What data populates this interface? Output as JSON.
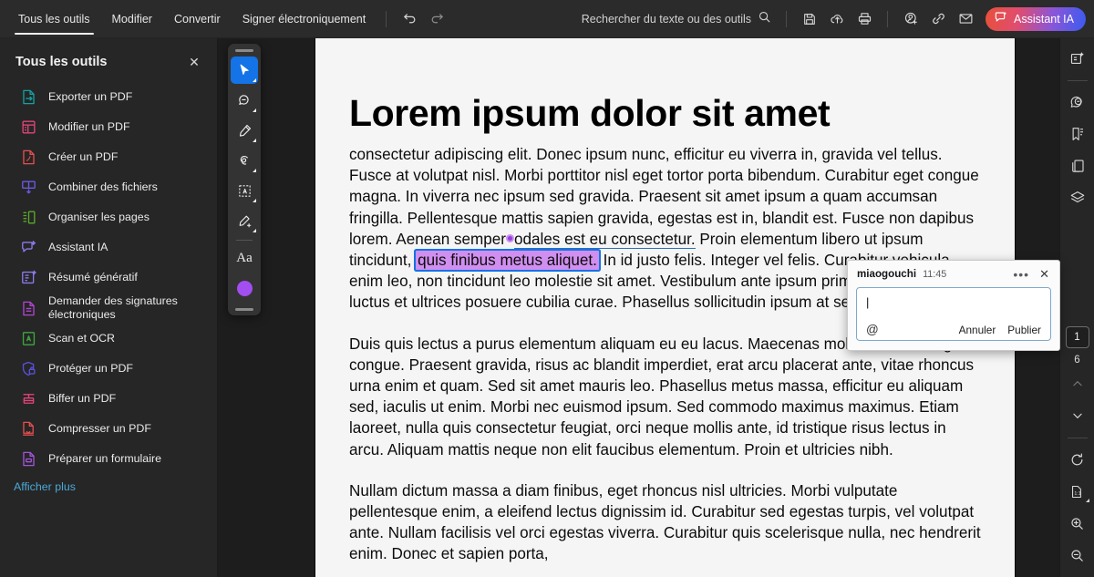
{
  "topbar": {
    "tabs": [
      {
        "label": "Tous les outils",
        "active": true
      },
      {
        "label": "Modifier",
        "active": false
      },
      {
        "label": "Convertir",
        "active": false
      },
      {
        "label": "Signer électroniquement",
        "active": false
      }
    ],
    "undo_name": "undo-icon",
    "redo_name": "redo-icon",
    "search_placeholder": "Rechercher du texte ou des outils",
    "icons": [
      "save-icon",
      "upload-cloud-icon",
      "print-icon",
      "add-person-icon",
      "link-icon",
      "mail-icon"
    ],
    "ai_button": "Assistant IA",
    "ai_gradient_from": "#e8503a",
    "ai_gradient_to": "#3a5bf0"
  },
  "sidebar": {
    "title": "Tous les outils",
    "close_label": "✕",
    "items": [
      {
        "label": "Exporter un PDF",
        "color": "#13a1a1"
      },
      {
        "label": "Modifier un PDF",
        "color": "#e0457b"
      },
      {
        "label": "Créer un PDF",
        "color": "#e34f4f"
      },
      {
        "label": "Combiner des fichiers",
        "color": "#6a5ae0"
      },
      {
        "label": "Organiser les pages",
        "color": "#5aa82b"
      },
      {
        "label": "Assistant IA",
        "color": "#8b7ae8"
      },
      {
        "label": "Résumé génératif",
        "color": "#8b7ae8"
      },
      {
        "label": "Demander des signatures électroniques",
        "color": "#b045d0"
      },
      {
        "label": "Scan et OCR",
        "color": "#3fa63f"
      },
      {
        "label": "Protéger un PDF",
        "color": "#5a50d8"
      },
      {
        "label": "Biffer un PDF",
        "color": "#e0457b"
      },
      {
        "label": "Compresser un PDF",
        "color": "#e34f4f"
      },
      {
        "label": "Préparer un formulaire",
        "color": "#a055d8"
      }
    ],
    "show_more": "Afficher plus",
    "show_more_color": "#4ba8d8"
  },
  "toolpalette": {
    "tools": [
      {
        "name": "select-cursor-tool",
        "selected": true,
        "has_caret": true
      },
      {
        "name": "comment-tool",
        "selected": false,
        "has_caret": true
      },
      {
        "name": "highlighter-tool",
        "selected": false,
        "has_caret": true
      },
      {
        "name": "freehand-draw-tool",
        "selected": false,
        "has_caret": true
      },
      {
        "name": "text-select-box-tool",
        "selected": false,
        "has_caret": true
      },
      {
        "name": "signature-tool",
        "selected": false,
        "has_caret": true
      }
    ],
    "text_tool_label": "Aa",
    "color_swatch": "#a24ef0"
  },
  "document": {
    "title": "Lorem ipsum dolor sit amet",
    "para1_a": "consectetur adipiscing elit. Donec ipsum nunc, efficitur eu viverra in, gravida vel tellus. Fusce at volutpat nisl. Morbi porttitor nisl eget tortor porta bibendum. Curabitur eget congue magna. In viverra nec ipsum sed gravida. Praesent sit amet ipsum a quam accumsan fringilla. Pellentesque mattis sapien gravida, egestas est in, blandit est. Fusce non dapibus lorem. Aenean semper",
    "para1_underlined": "odales est eu consectetur.",
    "para1_b": " Proin elementum libero ut ipsum tincidunt, ",
    "para1_highlight": "quis finibus metus aliquet.",
    "para1_c": " In id justo felis. Integer vel felis. Curabitur vehicula enim leo, non tincidunt leo molestie sit amet. Vestibulum ante ipsum primis in faucibus orci luctus et ultrices posuere cubilia curae. Phasellus sollicitudin ipsum at semper congue.",
    "para2": "Duis quis lectus a purus elementum aliquam eu eu lacus. Maecenas mollis tellus a fringilla congue. Praesent gravida, risus ac blandit imperdiet, erat arcu placerat ante, vitae rhoncus urna enim et quam. Sed sit amet mauris leo. Phasellus metus massa, efficitur eu aliquam sed, iaculis ut enim. Morbi nec euismod ipsum. Sed commodo maximus maximus. Etiam laoreet, nulla quis consectetur feugiat, orci neque mollis ante, id tristique risus lectus in arcu. Aliquam mattis neque non elit faucibus elementum. Proin et ultricies nibh.",
    "para3": "Nullam dictum massa a diam finibus, eget rhoncus nisl ultricies. Morbi vulputate pellentesque enim, a eleifend lectus dignissim id. Curabitur sed egestas turpis, vel volutpat ante. Nullam facilisis vel orci egestas viverra. Curabitur quis scelerisque nulla, nec hendrerit enim. Donec et sapien porta,",
    "highlight_color": "#d08ff0",
    "selection_border_color": "#1473e6"
  },
  "comment_popup": {
    "user": "miaogouchi",
    "time": "11:45",
    "menu_label": "•••",
    "close_label": "✕",
    "input_value": "",
    "caret": "|",
    "mention_label": "@",
    "cancel_label": "Annuler",
    "publish_label": "Publier"
  },
  "rail": {
    "top_icons": [
      "ai-summary-icon",
      "comments-icon",
      "bookmarks-icon",
      "page-thumbnails-icon",
      "layers-icon"
    ],
    "current_page": "1",
    "total_pages": "6",
    "prev_page_icon": "chevron-up-icon",
    "next_page_icon": "chevron-down-icon",
    "bottom_icons": [
      "rotate-icon",
      "fit-one-to-one-icon",
      "zoom-in-icon",
      "zoom-out-icon"
    ]
  }
}
